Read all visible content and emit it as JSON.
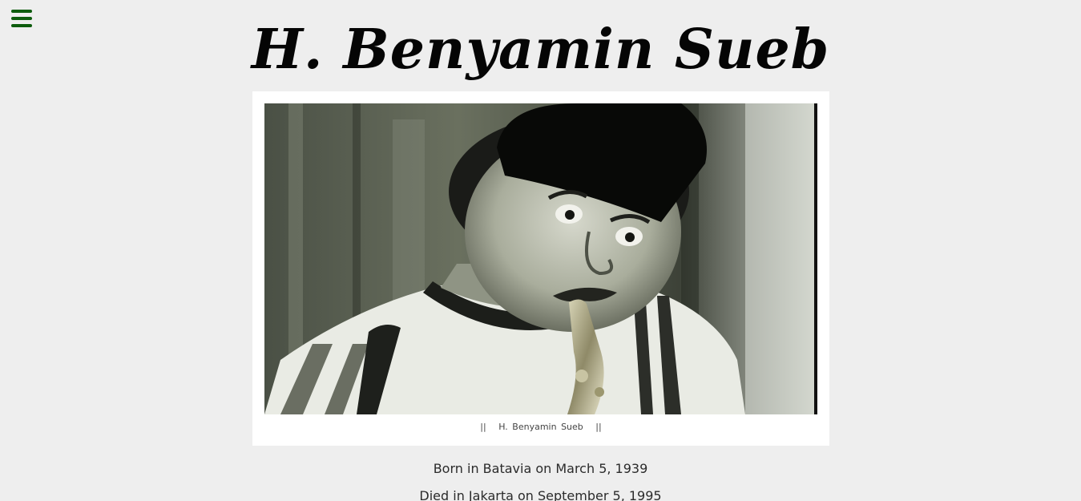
{
  "menu": {
    "icon": "hamburger-menu-icon",
    "color": "#0d5c0d"
  },
  "title": "H. Benyamin Sueb",
  "figure": {
    "image_description": "portrait-photo",
    "caption_left": "||",
    "caption_text": "H. Benyamin Sueb",
    "caption_right": "||"
  },
  "bio": {
    "born": "Born in Batavia on March 5, 1939",
    "died": "Died in Jakarta on September 5, 1995"
  },
  "colors": {
    "background": "#eeeeee",
    "card": "#ffffff",
    "title": "#050505"
  }
}
